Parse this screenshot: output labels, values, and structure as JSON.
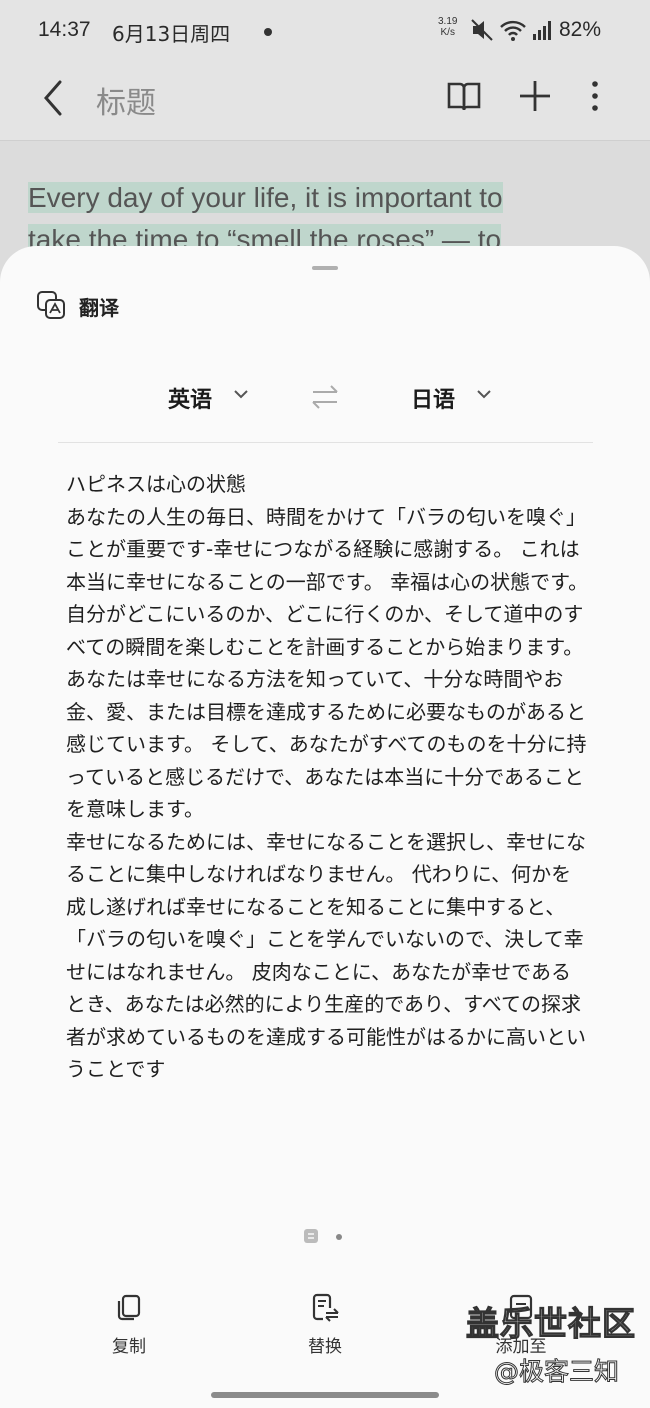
{
  "status_bar": {
    "time": "14:37",
    "date": "6月13日周四",
    "net_speed_value": "3.19",
    "net_speed_unit": "K/s",
    "battery": "82%",
    "icons": [
      "mute-icon",
      "wifi-icon",
      "signal-icon"
    ]
  },
  "app_bar": {
    "title": "标题",
    "icons": [
      "back-icon",
      "book-icon",
      "add-icon",
      "more-icon"
    ]
  },
  "note": {
    "line1": "Every day of your life, it is important to",
    "line2": "take the time to “smell the roses” — to"
  },
  "sheet": {
    "title": "翻译",
    "source_lang": "英语",
    "target_lang": "日语",
    "translation": [
      "ハピネスは心の状態",
      "あなたの人生の毎日、時間をかけて「バラの匂いを嗅ぐ」ことが重要です-幸せにつながる経験に感謝する。 これは本当に幸せになることの一部です。 幸福は心の状態です。 自分がどこにいるのか、どこに行くのか、そして道中のすべての瞬間を楽しむことを計画することから始まります。 あなたは幸せになる方法を知っていて、十分な時間やお金、愛、または目標を達成するために必要なものがあると感じています。 そして、あなたがすべてのものを十分に持っていると感じるだけで、あなたは本当に十分であることを意味します。",
      "幸せになるためには、幸せになることを選択し、幸せになることに集中しなければなりません。 代わりに、何かを成し遂げれば幸せになることを知ることに集中すると、「バラの匂いを嗅ぐ」ことを学んでいないので、決して幸せにはなれません。 皮肉なことに、あなたが幸せであるとき、あなたは必然的により生産的であり、すべての探求者が求めているものを達成する可能性がはるかに高いということです"
    ],
    "actions": {
      "copy": "复制",
      "replace": "替换",
      "add_to": "添加至"
    }
  },
  "watermark": {
    "line1": "盖乐世社区",
    "line2": "@极客三知"
  },
  "colors": {
    "highlight": "#bfd6cc",
    "sheet_bg": "#fafafa",
    "dim_bg": "#dcdcdc"
  }
}
